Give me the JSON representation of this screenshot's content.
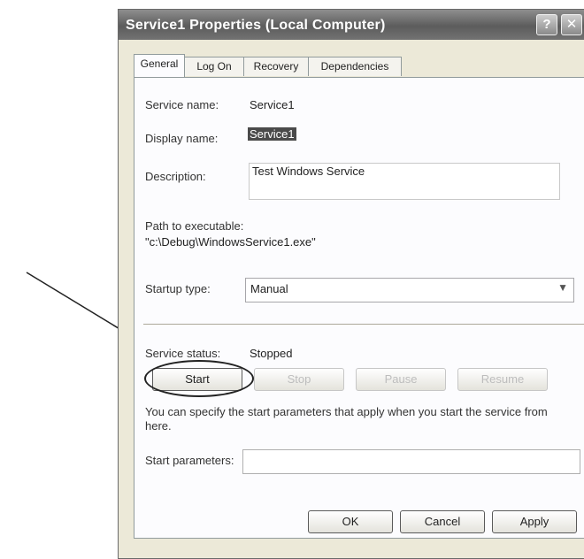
{
  "window": {
    "title": "Service1 Properties (Local Computer)",
    "help_glyph": "?",
    "close_glyph": "✕"
  },
  "tabs": [
    {
      "label": "General",
      "active": true
    },
    {
      "label": "Log On"
    },
    {
      "label": "Recovery"
    },
    {
      "label": "Dependencies"
    }
  ],
  "general": {
    "service_name_label": "Service name:",
    "service_name_value": "Service1",
    "display_name_label": "Display name:",
    "display_name_value": "Service1",
    "description_label": "Description:",
    "description_value": "Test Windows Service",
    "path_label": "Path to executable:",
    "path_value": "\"c:\\Debug\\WindowsService1.exe\"",
    "startup_type_label": "Startup type:",
    "startup_type_value": "Manual",
    "service_status_label": "Service status:",
    "service_status_value": "Stopped",
    "buttons": {
      "start": "Start",
      "stop": "Stop",
      "pause": "Pause",
      "resume": "Resume"
    },
    "start_params_note": "You can specify the start parameters that apply when you start the service from here.",
    "start_params_label": "Start parameters:"
  },
  "footer": {
    "ok": "OK",
    "cancel": "Cancel",
    "apply": "Apply"
  }
}
